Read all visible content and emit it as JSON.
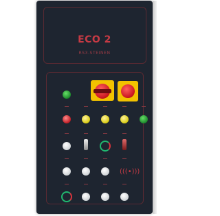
{
  "panel": {
    "title": "ECO 2",
    "subtitle": "RS3.STEINEN",
    "colors": {
      "body": "#1e2530",
      "accent": "#c63a44",
      "outline": "#5a2a32"
    }
  },
  "controls": {
    "row1": [
      {
        "name": "green-start-button",
        "type": "button-green"
      },
      {
        "name": "red-emergency-stop-switch",
        "type": "estop-large"
      },
      {
        "name": "red-emergency-stop-button",
        "type": "estop-small"
      }
    ],
    "row2": [
      {
        "name": "red-indicator-1",
        "type": "lamp-red"
      },
      {
        "name": "yellow-lamp-1",
        "type": "lamp-yellow"
      },
      {
        "name": "yellow-lamp-2",
        "type": "lamp-yellow"
      },
      {
        "name": "yellow-lamp-3",
        "type": "lamp-yellow"
      },
      {
        "name": "green-lamp",
        "type": "lamp-green"
      }
    ],
    "row3": [
      {
        "name": "white-button-1",
        "type": "button-white"
      },
      {
        "name": "selector-switch-1",
        "type": "toggle-white"
      },
      {
        "name": "mode-ring-dial",
        "type": "ring-dial"
      },
      {
        "name": "selector-switch-2",
        "type": "toggle-red"
      }
    ],
    "row4": [
      {
        "name": "white-button-2",
        "type": "button-white"
      },
      {
        "name": "white-button-3",
        "type": "button-white"
      },
      {
        "name": "white-button-4",
        "type": "button-white"
      },
      {
        "name": "horn-speaker",
        "type": "speaker"
      }
    ],
    "row5": [
      {
        "name": "ring-dial-2",
        "type": "ring-dial"
      },
      {
        "name": "white-button-5",
        "type": "button-white"
      },
      {
        "name": "white-button-6",
        "type": "button-white"
      },
      {
        "name": "white-button-7",
        "type": "button-white"
      }
    ]
  }
}
